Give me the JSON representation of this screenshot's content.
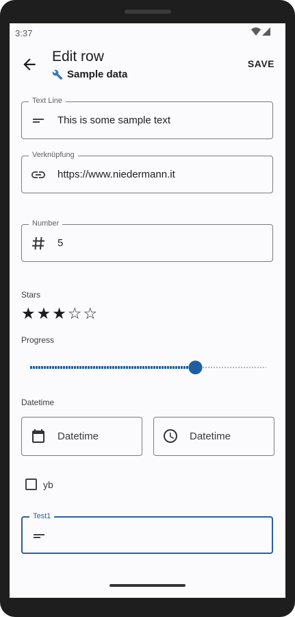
{
  "status": {
    "time": "3:37",
    "icons": [
      "wifi-icon",
      "signal-icon"
    ]
  },
  "appbar": {
    "title": "Edit row",
    "subtitle": "Sample data",
    "subtitle_icon": "wrench-icon",
    "save_label": "SAVE"
  },
  "fields": {
    "text_line": {
      "label": "Text Line",
      "value": "This is some sample text",
      "icon": "text-lines-icon"
    },
    "link": {
      "label": "Verknüpfung",
      "value": "https://www.niedermann.it",
      "icon": "link-icon"
    },
    "number": {
      "label": "Number",
      "value": "5",
      "icon": "hash-icon"
    }
  },
  "stars": {
    "label": "Stars",
    "rating": 3,
    "max": 5
  },
  "progress": {
    "label": "Progress",
    "value_fraction": 0.7
  },
  "datetime": {
    "label": "Datetime",
    "date_placeholder": "Datetime",
    "time_placeholder": "Datetime"
  },
  "checkbox": {
    "label": "yb",
    "checked": false
  },
  "test1": {
    "label": "Test1",
    "value": "",
    "icon": "text-lines-icon"
  },
  "colors": {
    "accent": "#2a5f9e",
    "slider_active": "#1e5fa3"
  }
}
